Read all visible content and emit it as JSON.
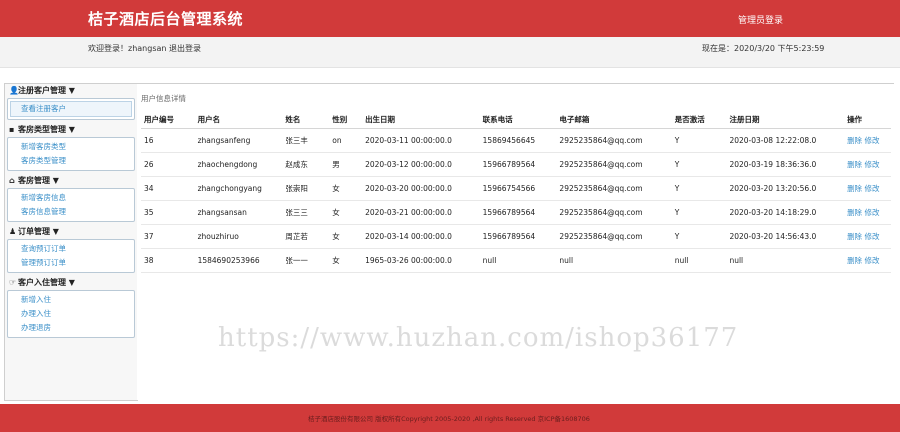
{
  "header": {
    "title": "桔子酒店后台管理系统",
    "login_link": "管理员登录"
  },
  "subbar": {
    "welcome": "欢迎登录！zhangsan 退出登录",
    "time": "现在是：2020/3/20 下午5:23:59"
  },
  "sidebar": {
    "groups": [
      {
        "icon": "user-icon",
        "icon_glyph": "👤",
        "title": "注册客户管理 ▼",
        "items": [
          {
            "label": "查看注册客户",
            "active": true
          }
        ]
      },
      {
        "icon": "bed-icon",
        "icon_glyph": "▪",
        "title": "客房类型管理 ▼",
        "items": [
          {
            "label": "新增客房类型"
          },
          {
            "label": "客房类型管理"
          }
        ]
      },
      {
        "icon": "home-icon",
        "icon_glyph": "⌂",
        "title": "客房管理 ▼",
        "items": [
          {
            "label": "新增客房信息"
          },
          {
            "label": "客房信息管理"
          }
        ]
      },
      {
        "icon": "bell-icon",
        "icon_glyph": "♟",
        "title": "订单管理 ▼",
        "items": [
          {
            "label": "查询预订订单"
          },
          {
            "label": "管理预订订单"
          }
        ]
      },
      {
        "icon": "hand-icon",
        "icon_glyph": "☞",
        "title": "客户入住管理 ▼",
        "items": [
          {
            "label": "新增入住"
          },
          {
            "label": "办理入住"
          },
          {
            "label": "办理退房"
          }
        ]
      }
    ]
  },
  "content": {
    "title": "用户信息详情",
    "columns": [
      "用户编号",
      "用户名",
      "姓名",
      "性别",
      "出生日期",
      "联系电话",
      "电子邮箱",
      "是否激活",
      "注册日期",
      "操作"
    ],
    "rows": [
      [
        "16",
        "zhangsanfeng",
        "张三丰",
        "on",
        "2020-03-11 00:00:00.0",
        "15869456645",
        "2925235864@qq.com",
        "Y",
        "2020-03-08 12:22:08.0",
        "删除 修改"
      ],
      [
        "26",
        "zhaochengdong",
        "赵成东",
        "男",
        "2020-03-12 00:00:00.0",
        "15966789564",
        "2925235864@qq.com",
        "Y",
        "2020-03-19 18:36:36.0",
        "删除 修改"
      ],
      [
        "34",
        "zhangchongyang",
        "张崇阳",
        "女",
        "2020-03-20 00:00:00.0",
        "15966754566",
        "2925235864@qq.com",
        "Y",
        "2020-03-20 13:20:56.0",
        "删除 修改"
      ],
      [
        "35",
        "zhangsansan",
        "张三三",
        "女",
        "2020-03-21 00:00:00.0",
        "15966789564",
        "2925235864@qq.com",
        "Y",
        "2020-03-20 14:18:29.0",
        "删除 修改"
      ],
      [
        "37",
        "zhouzhiruo",
        "周芷若",
        "女",
        "2020-03-14 00:00:00.0",
        "15966789564",
        "2925235864@qq.com",
        "Y",
        "2020-03-20 14:56:43.0",
        "删除 修改"
      ],
      [
        "38",
        "15846902539​66",
        "张一一",
        "女",
        "1965-03-26 00:00:00.0",
        "null",
        "null",
        "null",
        "null",
        "删除 修改"
      ]
    ]
  },
  "watermark": "https://www.huzhan.com/ishop36177",
  "footer": {
    "text": "桔子酒店股份有限公司 版权所有Copyright 2005-2020 ,All rights Reserved 京ICP备1608706"
  },
  "colors": {
    "brand_red": "#d13a3a",
    "link_blue": "#3a8fc8"
  }
}
